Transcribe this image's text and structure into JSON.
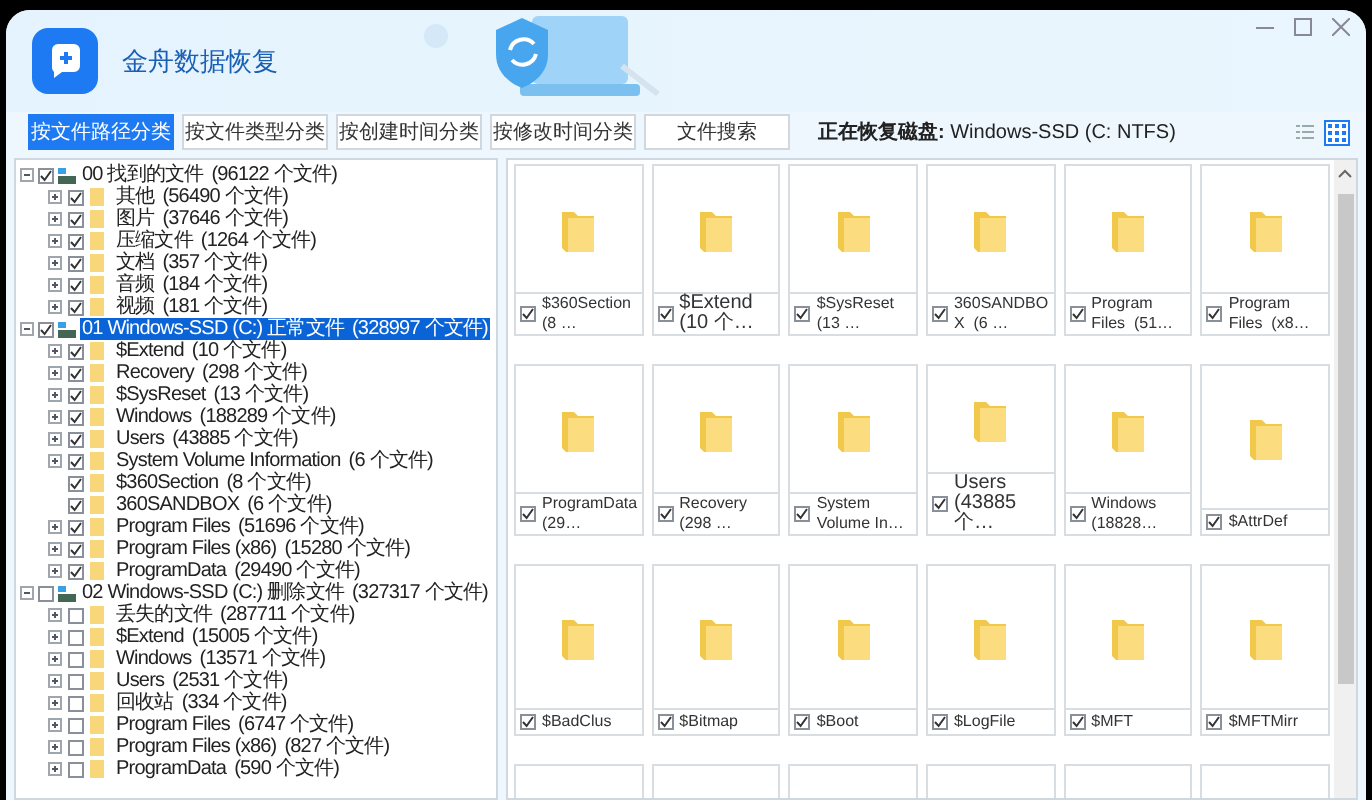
{
  "window": {
    "title": "金舟数据恢复"
  },
  "tabs": [
    {
      "label": "按文件路径分类",
      "selected": true
    },
    {
      "label": "按文件类型分类",
      "selected": false
    },
    {
      "label": "按创建时间分类",
      "selected": false
    },
    {
      "label": "按修改时间分类",
      "selected": false
    },
    {
      "label": "文件搜索",
      "selected": false
    }
  ],
  "recovering_disk": "**正在恢复磁盘:** Windows-SSD (C: NTFS)",
  "view_modes": [
    {
      "kind": "list",
      "selected": false
    },
    {
      "kind": "grid",
      "selected": true
    }
  ],
  "tree": [
    {
      "label": "00 找到的文件",
      "count": "(96122 个文件)",
      "checked": true,
      "expanded": true,
      "selected": false,
      "children": [
        {
          "label": "其他",
          "count": "(56490 个文件)",
          "checked": true,
          "expandable": true,
          "selected": false
        },
        {
          "label": "图片",
          "count": "(37646 个文件)",
          "checked": true,
          "expandable": true,
          "selected": false
        },
        {
          "label": "压缩文件",
          "count": "(1264 个文件)",
          "checked": true,
          "expandable": true,
          "selected": false
        },
        {
          "label": "文档",
          "count": "(357 个文件)",
          "checked": true,
          "expandable": true,
          "selected": false
        },
        {
          "label": "音频",
          "count": "(184 个文件)",
          "checked": true,
          "expandable": true,
          "selected": false
        },
        {
          "label": "视频",
          "count": "(181 个文件)",
          "checked": true,
          "expandable": true,
          "selected": false
        }
      ]
    },
    {
      "label": "01 Windows-SSD (C:) 正常文件",
      "count": "(328997 个文件)",
      "checked": true,
      "expanded": true,
      "selected": true,
      "children": [
        {
          "label": "$Extend",
          "count": "(10 个文件)",
          "checked": true,
          "expandable": true,
          "selected": false
        },
        {
          "label": "Recovery",
          "count": "(298 个文件)",
          "checked": true,
          "expandable": true,
          "selected": false
        },
        {
          "label": "$SysReset",
          "count": "(13 个文件)",
          "checked": true,
          "expandable": true,
          "selected": false
        },
        {
          "label": "Windows",
          "count": "(188289 个文件)",
          "checked": true,
          "expandable": true,
          "selected": false
        },
        {
          "label": "Users",
          "count": "(43885 个文件)",
          "checked": true,
          "expandable": true,
          "selected": false
        },
        {
          "label": "System Volume Information",
          "count": "(6 个文件)",
          "checked": true,
          "expandable": true,
          "selected": false
        },
        {
          "label": "$360Section",
          "count": "(8 个文件)",
          "checked": true,
          "expandable": false,
          "selected": false
        },
        {
          "label": "360SANDBOX",
          "count": "(6 个文件)",
          "checked": true,
          "expandable": false,
          "selected": false
        },
        {
          "label": "Program Files",
          "count": "(51696 个文件)",
          "checked": true,
          "expandable": true,
          "selected": false
        },
        {
          "label": "Program Files (x86)",
          "count": "(15280 个文件)",
          "checked": true,
          "expandable": true,
          "selected": false
        },
        {
          "label": "ProgramData",
          "count": "(29490 个文件)",
          "checked": true,
          "expandable": true,
          "selected": false
        }
      ]
    },
    {
      "label": "02 Windows-SSD (C:) 删除文件",
      "count": "(327317 个文件)",
      "checked": false,
      "expanded": true,
      "selected": false,
      "children": [
        {
          "label": "丢失的文件",
          "count": "(287711 个文件)",
          "checked": false,
          "expandable": true,
          "selected": false
        },
        {
          "label": "$Extend",
          "count": "(15005 个文件)",
          "checked": false,
          "expandable": true,
          "selected": false
        },
        {
          "label": "Windows",
          "count": "(13571 个文件)",
          "checked": false,
          "expandable": true,
          "selected": false
        },
        {
          "label": "Users",
          "count": "(2531 个文件)",
          "checked": false,
          "expandable": true,
          "selected": false
        },
        {
          "label": "回收站",
          "count": "(334 个文件)",
          "checked": false,
          "expandable": true,
          "selected": false
        },
        {
          "label": "Program Files",
          "count": "(6747 个文件)",
          "checked": false,
          "expandable": true,
          "selected": false
        },
        {
          "label": "Program Files (x86)",
          "count": "(827 个文件)",
          "checked": false,
          "expandable": true,
          "selected": false
        },
        {
          "label": "ProgramData",
          "count": "(590 个文件)",
          "checked": false,
          "expandable": true,
          "selected": false
        }
      ]
    }
  ],
  "tiles": [
    {
      "label": "$360Section  (8 …",
      "checked": true
    },
    {
      "label": "$Extend  (10 个…",
      "checked": true
    },
    {
      "label": "$SysReset  (13 …",
      "checked": true
    },
    {
      "label": "360SANDBOX  (6 …",
      "checked": true
    },
    {
      "label": "Program Files  (51…",
      "checked": true
    },
    {
      "label": "Program Files  (x8…",
      "checked": true
    },
    {
      "label": "ProgramData  (29…",
      "checked": true
    },
    {
      "label": "Recovery  (298 …",
      "checked": true
    },
    {
      "label": "System Volume In…",
      "checked": true
    },
    {
      "label": "Users  (43885 个…",
      "checked": true
    },
    {
      "label": "Windows  (18828…",
      "checked": true
    },
    {
      "label": "$AttrDef",
      "checked": true
    },
    {
      "label": "$BadClus",
      "checked": true
    },
    {
      "label": "$Bitmap",
      "checked": true
    },
    {
      "label": "$Boot",
      "checked": true
    },
    {
      "label": "$LogFile",
      "checked": true
    },
    {
      "label": "$MFT",
      "checked": true
    },
    {
      "label": "$MFTMirr",
      "checked": true
    }
  ]
}
